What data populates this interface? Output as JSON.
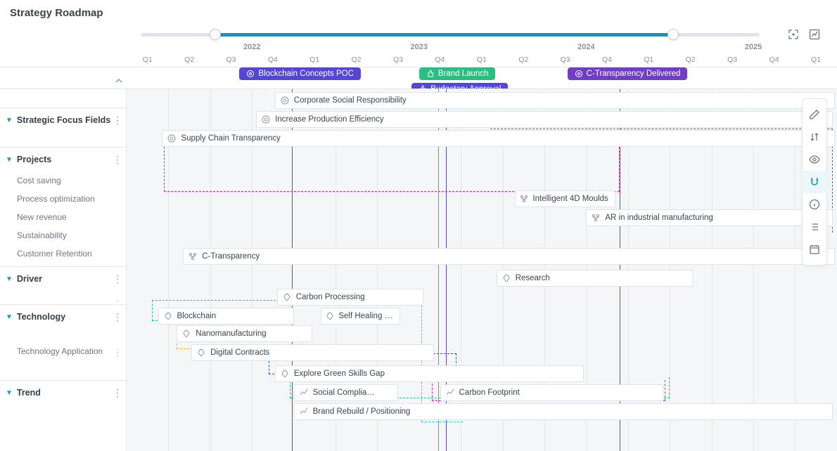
{
  "title": "Strategy Roadmap",
  "years": [
    "2022",
    "2023",
    "2024",
    "2025"
  ],
  "quarters": [
    "Q1",
    "Q2",
    "Q3",
    "Q4",
    "Q1",
    "Q2",
    "Q3",
    "Q4",
    "Q1",
    "Q2",
    "Q3",
    "Q4",
    "Q1",
    "Q2",
    "Q3",
    "Q4",
    "Q1"
  ],
  "milestones": {
    "blockchain": "Blockchain Concepts POC",
    "brand": "Brand Launch",
    "ctrans": "C-Transparency Delivered",
    "budget": "Budgetary Approval"
  },
  "sidebar": {
    "strategic": "Strategic Focus Fields",
    "projects": "Projects",
    "proj_items": {
      "cost": "Cost saving",
      "proc": "Process optimization",
      "rev": "New revenue",
      "sust": "Sustainability",
      "cust": "Customer Retention"
    },
    "driver": "Driver",
    "tech": "Technology",
    "tech_items": {
      "app": "Technology Application"
    },
    "trend": "Trend"
  },
  "bars": {
    "csr": "Corporate Social Responsibility",
    "prodeff": "Increase Production Efficiency",
    "supply": "Supply Chain Transparency",
    "4dmoulds": "Intelligent 4D Moulds",
    "ar": "AR in industrial manufacturing",
    "ctrans": "C-Transparency",
    "research": "Research",
    "carbonproc": "Carbon Processing",
    "blockchain": "Blockchain",
    "selfheal": "Self Healing …",
    "nano": "Nanomanufacturing",
    "digital": "Digital Contracts",
    "greenskills": "Explore Green Skills Gap",
    "social": "Social Complia…",
    "footprint": "Carbon Footprint",
    "brandre": "Brand Rebuild / Positioning"
  }
}
